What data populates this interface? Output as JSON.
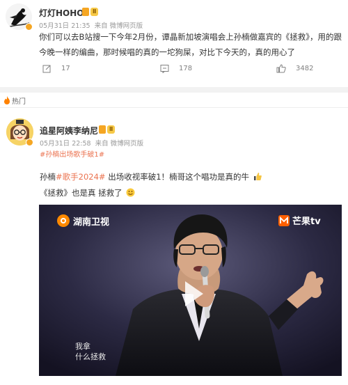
{
  "post1": {
    "username": "灯灯HOHO",
    "level_badge": "Ⅱ",
    "time": "05月31日 21:35",
    "source_prefix": "来自",
    "source": "微博网页版",
    "text_line1": "你们可以去B站搜一下今年2月份，谭晶新加坡演唱会上孙楠做嘉宾的《拯救》，用的跟",
    "text_line2": "今晚一样的编曲，那时候唱的真的一坨狗屎，对比下今天的，真的用心了",
    "reposts": "17",
    "comments": "178",
    "likes": "3482"
  },
  "hot_section": {
    "label": "热门"
  },
  "post2": {
    "username": "追星阿姨李纳尼",
    "level_badge": "Ⅱ",
    "time": "05月31日 22:58",
    "source_prefix": "来自",
    "source": "微博网页版",
    "topic_tag": "#孙楠出场歌手破1#",
    "text_part1": "孙楠",
    "text_tag": "#歌手2024#",
    "text_part2": " 出场收视率破1！楠哥这个唱功是真的牛",
    "text_line2": "《拯救》也是真 拯救了",
    "video": {
      "channel_logo": "湖南卫视",
      "brand_logo": "芒果tv",
      "subtitle_line1": "我拿",
      "subtitle_line2": "什么拯救"
    }
  },
  "colors": {
    "accent_orange": "#eb7350",
    "badge_gold": "#f7c948",
    "meta_gray": "#999999",
    "separator": "#f2f2f2"
  }
}
